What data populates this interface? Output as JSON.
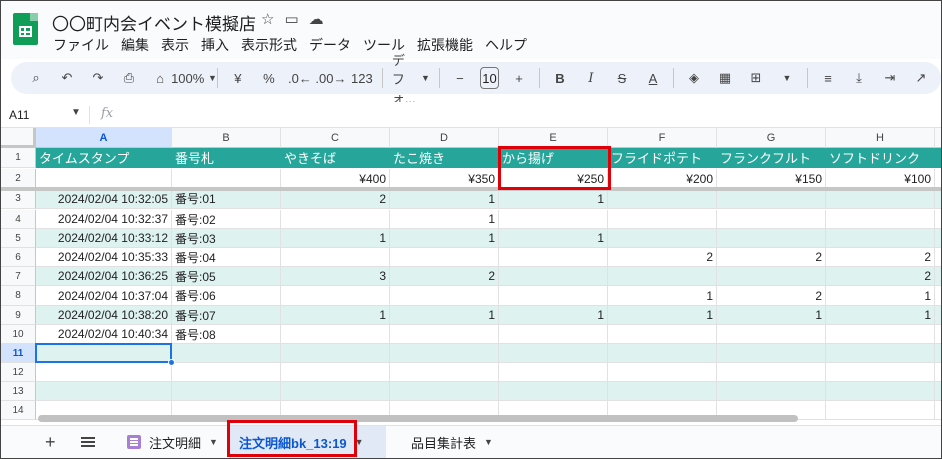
{
  "app": {
    "title": "〇〇町内会イベント模擬店",
    "menu": [
      "ファイル",
      "編集",
      "表示",
      "挿入",
      "表示形式",
      "データ",
      "ツール",
      "拡張機能",
      "ヘルプ"
    ]
  },
  "toolbar": {
    "zoom": "100%",
    "currency": "¥",
    "percent": "%",
    "dec_decrease": ".0←",
    "dec_increase": ".00→",
    "format_123": "123",
    "font": "デフォ...",
    "font_size": "10",
    "bold": "B",
    "italic": "I",
    "strike": "S",
    "text_color": "A"
  },
  "formula_bar": {
    "name_box": "A11",
    "fx": "fx",
    "formula": ""
  },
  "grid": {
    "columns": [
      "A",
      "B",
      "C",
      "D",
      "E",
      "F",
      "G",
      "H"
    ],
    "selected_column": "A",
    "selected_cell": "A11",
    "header_row": [
      "タイムスタンプ",
      "番号札",
      "やきそば",
      "たこ焼き",
      "から揚げ",
      "フライドポテト",
      "フランクフルト",
      "ソフトドリンク"
    ],
    "price_row": [
      "",
      "",
      "¥400",
      "¥350",
      "¥250",
      "¥200",
      "¥150",
      "¥100"
    ],
    "data_rows": [
      [
        "2024/02/04 10:32:05",
        "番号:01",
        "2",
        "1",
        "1",
        "",
        "",
        ""
      ],
      [
        "2024/02/04 10:32:37",
        "番号:02",
        "",
        "1",
        "",
        "",
        "",
        ""
      ],
      [
        "2024/02/04 10:33:12",
        "番号:03",
        "1",
        "1",
        "1",
        "",
        "",
        ""
      ],
      [
        "2024/02/04 10:35:33",
        "番号:04",
        "",
        "",
        "",
        "2",
        "2",
        "2"
      ],
      [
        "2024/02/04 10:36:25",
        "番号:05",
        "3",
        "2",
        "",
        "",
        "",
        "2"
      ],
      [
        "2024/02/04 10:37:04",
        "番号:06",
        "",
        "",
        "",
        "1",
        "2",
        "1"
      ],
      [
        "2024/02/04 10:38:20",
        "番号:07",
        "1",
        "1",
        "1",
        "1",
        "1",
        "1"
      ],
      [
        "2024/02/04 10:40:34",
        "番号:08",
        "",
        "",
        "",
        "",
        "",
        ""
      ]
    ],
    "row_numbers": [
      "1",
      "2",
      "3",
      "4",
      "5",
      "6",
      "7",
      "8",
      "9",
      "10",
      "11",
      "12",
      "13",
      "14"
    ],
    "header_color": "#26a69a",
    "band_color": "#def2f0",
    "highlight_color": "#e0000a"
  },
  "sheets": {
    "tabs": [
      {
        "label": "注文明細",
        "active": false
      },
      {
        "label": "注文明細bk_13:19",
        "active": true
      },
      {
        "label": "品目集計表",
        "active": false
      }
    ]
  }
}
